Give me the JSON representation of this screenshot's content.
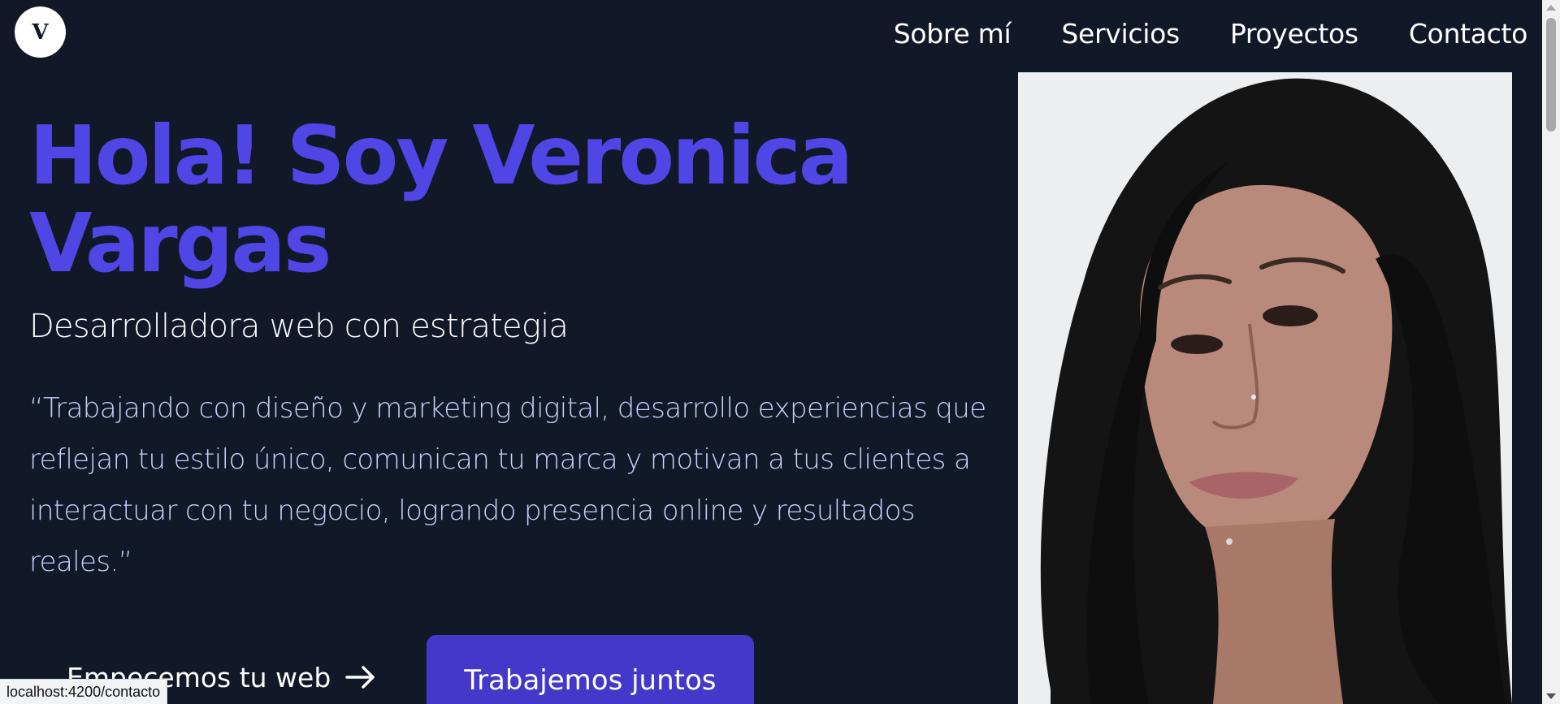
{
  "header": {
    "logo_letter": "V",
    "nav": [
      "Sobre mí",
      "Servicios",
      "Proyectos",
      "Contacto"
    ]
  },
  "hero": {
    "title": "Hola! Soy Veronica Vargas",
    "subtitle": "Desarrolladora web con estrategia",
    "quote": "“Trabajando con diseño y marketing digital, desarrollo experiencias que reflejan tu estilo único, comunican tu marca y motivan a tus clientes a interactuar con tu negocio, logrando presencia online y resultados reales.”",
    "cta_link": "Empecemos tu web",
    "cta_button": "Trabajemos juntos"
  },
  "portrait": {
    "icon": "profile-photo"
  },
  "status_bar": {
    "url": "localhost:4200/contacto"
  },
  "colors": {
    "background": "#111827",
    "accent": "#4f46e5",
    "button": "#4338ca",
    "quote_text": "#c7d2fe"
  }
}
